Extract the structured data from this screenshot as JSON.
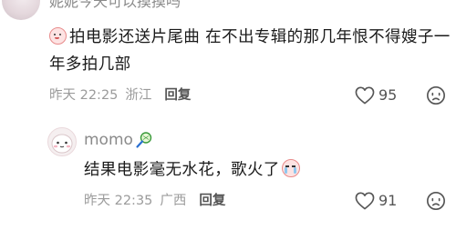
{
  "comments": [
    {
      "username": "妮妮今天可以摸摸吗",
      "text": "拍电影还送片尾曲 在不出专辑的那几年恨不得嫂子一年多拍几部",
      "time": "昨天 22:25",
      "location": "浙江",
      "reply_label": "回复",
      "likes": "95",
      "emoji_icon": "smiling-face-emoji"
    },
    {
      "username": "momo",
      "text": "结果电影毫无水花，歌火了",
      "time": "昨天 22:35",
      "location": "广西",
      "reply_label": "回复",
      "likes": "91",
      "username_icon": "tennis-racket-icon",
      "emoji_icon": "crying-face-emoji"
    }
  ],
  "colors": {
    "text_primary": "#1a1a1a",
    "text_meta": "#9b9b9b",
    "emoji_outline": "#e88b8b",
    "emoji_fill": "#fde3e3"
  }
}
